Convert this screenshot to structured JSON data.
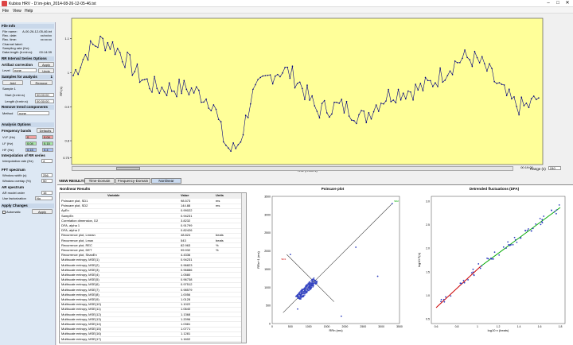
{
  "window": {
    "title": "Kubios HRV - D:\\m-jokn_2014-08-26-12-05-46.txt",
    "controls": [
      "–",
      "□",
      "✕"
    ]
  },
  "menu": [
    "File",
    "View",
    "Help"
  ],
  "left": {
    "file_info_title": "File Info",
    "file_info": [
      [
        "File name:",
        "A-00-26-12-05-46.txt"
      ],
      [
        "Rec. date:",
        "xx/xx/xx"
      ],
      [
        "Rec. time:",
        "xx:xx:xx"
      ],
      [
        "Channel label:",
        ""
      ],
      [
        "Sampling rate (Hz):",
        ""
      ],
      [
        "Data length (h:min:s):",
        "00:14:39"
      ]
    ],
    "rr_title": "RR Interval Series Options",
    "artifact_title": "Artifact correction",
    "artifact_level_label": "Level",
    "artifact_level_value": "none",
    "apply_label": "Apply",
    "undo_label": "Undo",
    "samples_title": "Samples for analysis",
    "samples_count": "1",
    "add_label": "Add",
    "remove_label": "Remove",
    "sample_name": "Sample 1",
    "start_label": "Start (h:min:s)",
    "start_value": "00:00:00",
    "length_label": "Length (h:min:s)",
    "length_value": "00:30:00",
    "trend_title": "Remove trend components",
    "method_label": "Method",
    "method_value": "none",
    "analysis_title": "Analysis Options",
    "freq_title": "Frequency bands",
    "defaults_label": "Defaults",
    "vlf_label": "VLF (Hz)",
    "vlf_a": "0",
    "vlf_b": "0.04",
    "lf_label": "LF (Hz)",
    "lf_a": "0.04",
    "lf_b": "0.15",
    "hf_label": "HF (Hz)",
    "hf_a": "0.15",
    "hf_b": "0.4",
    "interp_title": "Interpolation of RR series",
    "interp_label": "Interpolation rate (Hz)",
    "interp_value": "4",
    "fft_title": "FFT spectrum",
    "win_width_label": "Window width (s)",
    "win_width_value": "256",
    "win_overlap_label": "Window overlap (%)",
    "win_overlap_value": "50",
    "ar_title": "AR spectrum",
    "ar_order_label": "AR model order",
    "ar_order_value": "16",
    "ar_fact_label": "Use factorization",
    "ar_fact_value": "No",
    "apply_changes_title": "Apply Changes",
    "automatic_label": "Automatic",
    "apply2_label": "Apply"
  },
  "rrplot": {
    "ylabel": "RR (s)",
    "xlabel": "Time (h:min:s)",
    "yticks": [
      "1.1",
      "1",
      "0.9",
      "0.8",
      "0.75"
    ],
    "yvals": [
      1.1,
      1.0,
      0.9,
      0.8,
      0.75
    ],
    "xticks": [
      "00:15:00",
      "00:16:00",
      "00:17:00",
      "00:18:00",
      "00:19:00"
    ],
    "range_label": "Range (s)",
    "range_value": "240",
    "ymin": 0.73,
    "ymax": 1.16
  },
  "tabs": [
    "VIEW RESULTS",
    "Time-Domain",
    "Frequency-Domain",
    "Nonlinear"
  ],
  "table": {
    "title": "Nonlinear Results",
    "headers": [
      "Variable",
      "Value",
      "Units"
    ],
    "rows": [
      [
        "Poincare plot, SD1",
        "98.573",
        "ms"
      ],
      [
        "Poincare plot, SD2",
        "144.88",
        "ms"
      ],
      [
        "ApEn",
        "0.99022",
        ""
      ],
      [
        "SampEn",
        "0.94231",
        ""
      ],
      [
        "Correlation dimension, D2",
        "3.8232",
        ""
      ],
      [
        "DFA, alpha 1",
        "0.91799",
        ""
      ],
      [
        "DFA, alpha 2",
        "0.82426",
        ""
      ],
      [
        "Recurrence plot, Lmean",
        "48.824",
        "beats"
      ],
      [
        "Recurrence plot, Lmax",
        "543",
        "beats"
      ],
      [
        "Recurrence plot, REC",
        "82.963",
        "%"
      ],
      [
        "Recurrence plot, DET",
        "99.932",
        "%"
      ],
      [
        "Recurrence plot, ShanEn",
        "4.4336",
        ""
      ],
      [
        "Multiscale entropy, MSE(1)",
        "0.94231",
        ""
      ],
      [
        "Multiscale entropy, MSE(2)",
        "0.96823",
        ""
      ],
      [
        "Multiscale entropy, MSE(3)",
        "0.96886",
        ""
      ],
      [
        "Multiscale entropy, MSE(4)",
        "1.0580",
        ""
      ],
      [
        "Multiscale entropy, MSE(5)",
        "0.96738",
        ""
      ],
      [
        "Multiscale entropy, MSE(6)",
        "0.97512",
        ""
      ],
      [
        "Multiscale entropy, MSE(7)",
        "0.98579",
        ""
      ],
      [
        "Multiscale entropy, MSE(8)",
        "1.0056",
        ""
      ],
      [
        "Multiscale entropy, MSE(9)",
        "1.0128",
        ""
      ],
      [
        "Multiscale entropy, MSE(10)",
        "1.1022",
        ""
      ],
      [
        "Multiscale entropy, MSE(11)",
        "1.0640",
        ""
      ],
      [
        "Multiscale entropy, MSE(12)",
        "1.1368",
        ""
      ],
      [
        "Multiscale entropy, MSE(13)",
        "1.2096",
        ""
      ],
      [
        "Multiscale entropy, MSE(14)",
        "1.0381",
        ""
      ],
      [
        "Multiscale entropy, MSE(15)",
        "1.0771",
        ""
      ],
      [
        "Multiscale entropy, MSE(16)",
        "1.1281",
        ""
      ],
      [
        "Multiscale entropy, MSE(17)",
        "1.1602",
        ""
      ],
      [
        "Multiscale entropy, MSE(18)",
        "1.2052",
        ""
      ]
    ]
  },
  "poincare": {
    "title": "Poincare plot",
    "xlabel": "RRn (ms)",
    "ylabel": "RRn+1 (ms)",
    "ticks": [
      "0",
      "500",
      "1000",
      "1500",
      "2000",
      "2500",
      "3000",
      "3500"
    ],
    "yticks": [
      "3500",
      "3000",
      "2500",
      "2000",
      "1500",
      "1000",
      "500",
      "0"
    ],
    "sd1_label": "SD1",
    "sd2_label": "SD2"
  },
  "dfa": {
    "title": "Detrended fluctuations (DFA)",
    "xlabel": "log10 n (beats)",
    "ylabel": "log10 F(n)",
    "xticks": [
      "0.6",
      "0.8",
      "1",
      "1.2",
      "1.4",
      "1.6",
      "1.8"
    ],
    "yticks": [
      "3.0",
      "2.5",
      "2.0",
      "1.5",
      "1.0",
      "0.5"
    ]
  },
  "colors": {
    "plot_bg": "#ffff99",
    "line": "#000080",
    "red": "#cc0000",
    "green": "#00aa00",
    "panel": "#dde8f4"
  }
}
